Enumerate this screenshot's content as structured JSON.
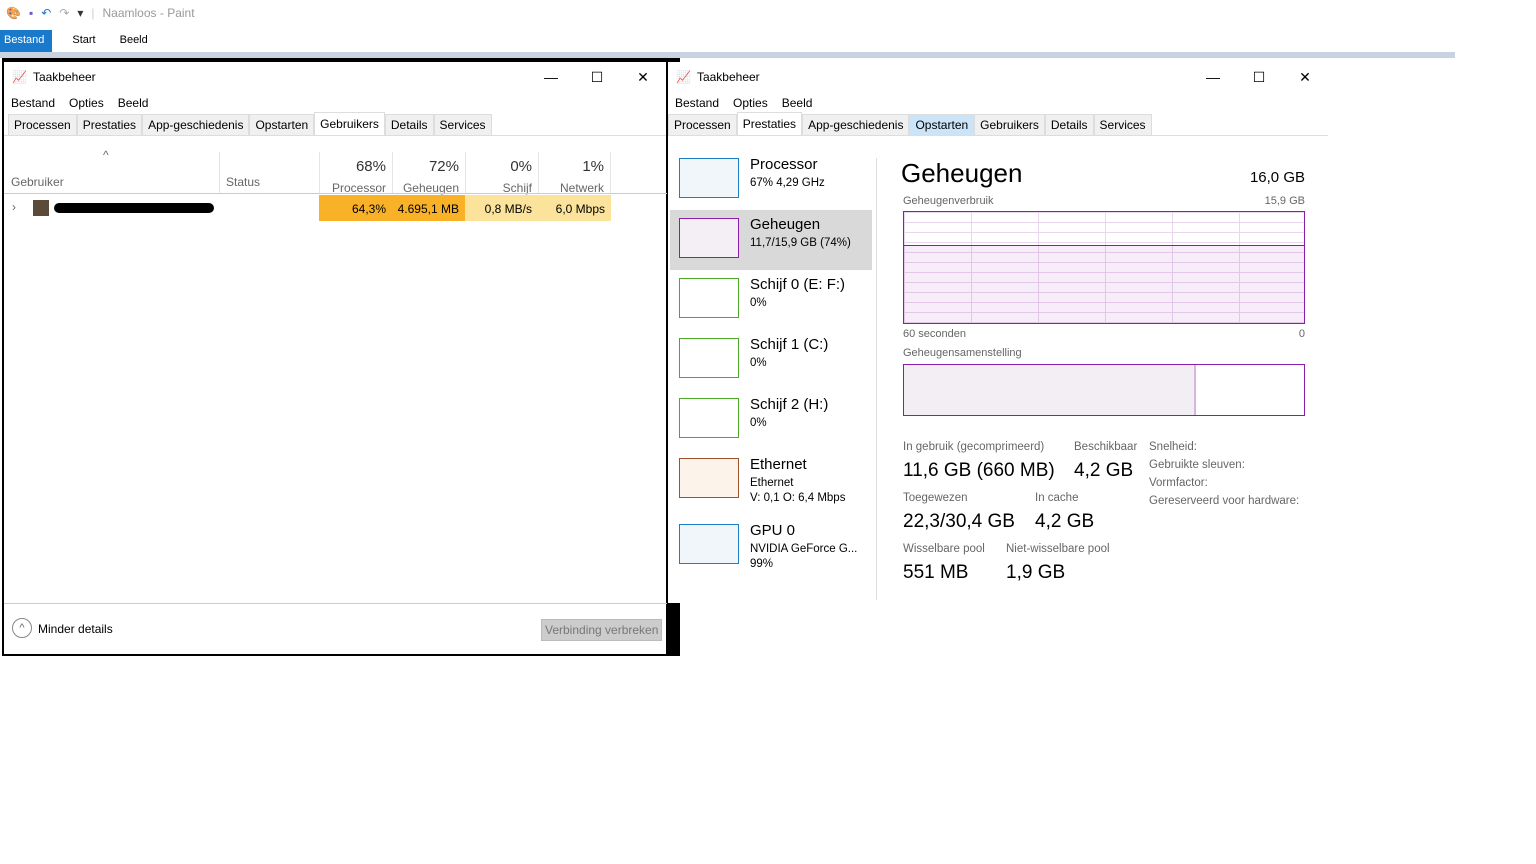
{
  "paint": {
    "title": "Naamloos - Paint",
    "menu": [
      "Bestand",
      "Start",
      "Beeld"
    ]
  },
  "left": {
    "title": "Taakbeheer",
    "menu": [
      "Bestand",
      "Opties",
      "Beeld"
    ],
    "tabs": [
      "Processen",
      "Prestaties",
      "App-geschiedenis",
      "Opstarten",
      "Gebruikers",
      "Details",
      "Services"
    ],
    "columns": {
      "user": "Gebruiker",
      "status": "Status",
      "cpu_pct": "68%",
      "cpu": "Processor",
      "mem_pct": "72%",
      "mem": "Geheugen",
      "disk_pct": "0%",
      "disk": "Schijf",
      "net_pct": "1%",
      "net": "Netwerk"
    },
    "row": {
      "cpu": "64,3%",
      "mem": "4.695,1 MB",
      "disk": "0,8 MB/s",
      "net": "6,0 Mbps"
    },
    "less_details": "Minder details",
    "disconnect": "Verbinding verbreken"
  },
  "right": {
    "title": "Taakbeheer",
    "menu": [
      "Bestand",
      "Opties",
      "Beeld"
    ],
    "tabs": [
      "Processen",
      "Prestaties",
      "App-geschiedenis",
      "Opstarten",
      "Gebruikers",
      "Details",
      "Services"
    ],
    "sidebar": [
      {
        "title": "Processor",
        "sub": "67% 4,29 GHz",
        "color": "#1b7fc2"
      },
      {
        "title": "Geheugen",
        "sub": "11,7/15,9 GB (74%)",
        "color": "#8b1ea8"
      },
      {
        "title": "Schijf 0 (E: F:)",
        "sub": "0%",
        "color": "#4da82a"
      },
      {
        "title": "Schijf 1 (C:)",
        "sub": "0%",
        "color": "#4da82a"
      },
      {
        "title": "Schijf 2 (H:)",
        "sub": "0%",
        "color": "#4da82a"
      },
      {
        "title": "Ethernet",
        "sub": "Ethernet",
        "sub2": "V: 0,1 O: 6,4 Mbps",
        "color": "#a0522d"
      },
      {
        "title": "GPU 0",
        "sub": "NVIDIA GeForce G...",
        "sub2": "99%",
        "color": "#1b7fc2"
      }
    ],
    "main": {
      "title": "Geheugen",
      "total": "16,0 GB",
      "usage_label": "Geheugenverbruik",
      "usage_max": "15,9 GB",
      "time_left": "60 seconden",
      "time_right": "0",
      "usage_fraction": 0.74,
      "composition_label": "Geheugensamenstelling",
      "composition_used_fraction": 0.73,
      "stats": {
        "in_use_label": "In gebruik (gecomprimeerd)",
        "in_use": "11,6 GB (660 MB)",
        "available_label": "Beschikbaar",
        "available": "4,2 GB",
        "committed_label": "Toegewezen",
        "committed": "22,3/30,4 GB",
        "cached_label": "In cache",
        "cached": "4,2 GB",
        "paged_label": "Wisselbare pool",
        "paged": "551 MB",
        "nonpaged_label": "Niet-wisselbare pool",
        "nonpaged": "1,9 GB",
        "speed": "Snelheid:",
        "slots": "Gebruikte sleuven:",
        "form": "Vormfactor:",
        "reserved": "Gereserveerd voor hardware:"
      }
    }
  }
}
